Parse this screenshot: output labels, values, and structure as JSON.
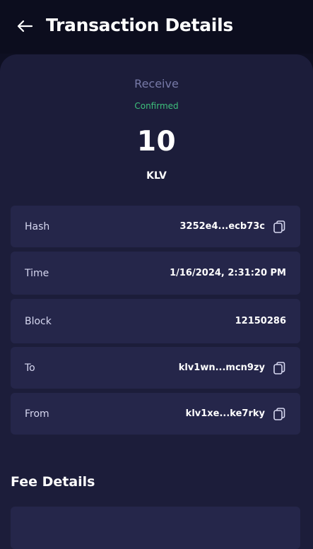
{
  "header": {
    "title": "Transaction Details"
  },
  "summary": {
    "type": "Receive",
    "status": "Confirmed",
    "amount": "10",
    "currency": "KLV"
  },
  "details": {
    "hash": {
      "label": "Hash",
      "value": "3252e4...ecb73c"
    },
    "time": {
      "label": "Time",
      "value": "1/16/2024, 2:31:20 PM"
    },
    "block": {
      "label": "Block",
      "value": "12150286"
    },
    "to": {
      "label": "To",
      "value": "klv1wn...mcn9zy"
    },
    "from": {
      "label": "From",
      "value": "klv1xe...ke7rky"
    }
  },
  "fee": {
    "title": "Fee Details"
  },
  "colors": {
    "background": "#0e0f22",
    "card": "#1c1d3a",
    "row": "#25264a",
    "status_green": "#3ec07c",
    "muted": "#777aa8"
  }
}
